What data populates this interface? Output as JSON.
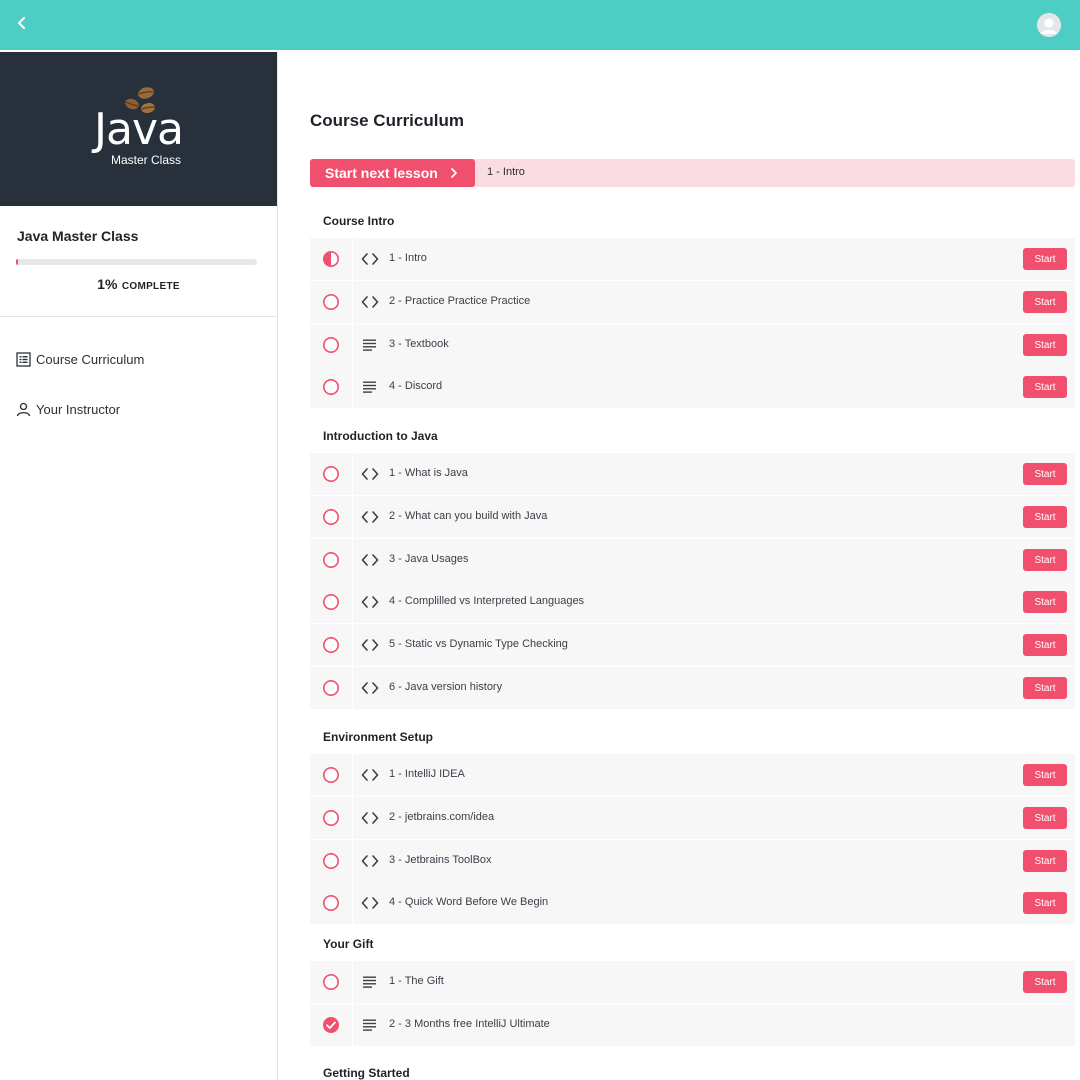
{
  "colors": {
    "topbar": "#4ecdc4",
    "accent": "#f0506e",
    "sidebar_header": "#28303c",
    "next_bar": "#fadce2"
  },
  "topbar": {
    "back_icon": "chevron-left-icon",
    "avatar_icon": "user-avatar-icon"
  },
  "logo": {
    "title": "Java",
    "subtitle": "Master Class",
    "icon": "coffee-beans-icon"
  },
  "sidebar": {
    "course_title": "Java Master Class",
    "progress_percent": 1,
    "progress_value": "1%",
    "progress_label": "COMPLETE",
    "nav": [
      {
        "label": "Course Curriculum",
        "icon": "list-icon"
      },
      {
        "label": "Your Instructor",
        "icon": "person-icon"
      }
    ]
  },
  "main": {
    "title": "Course Curriculum",
    "next_button": "Start next lesson",
    "next_lesson": "1 - Intro",
    "sections": [
      {
        "title": "Course Intro",
        "lessons": [
          {
            "name": "1 - Intro",
            "type": "code",
            "status": "half",
            "action": "Start"
          },
          {
            "name": "2 - Practice Practice Practice",
            "type": "code",
            "status": "empty",
            "action": "Start"
          },
          {
            "name": "3 - Textbook",
            "type": "text",
            "status": "empty",
            "action": "Start"
          },
          {
            "name": "4 - Discord",
            "type": "text",
            "status": "empty",
            "action": "Start"
          }
        ]
      },
      {
        "title": "Introduction to Java",
        "lessons": [
          {
            "name": "1 - What is Java",
            "type": "code",
            "status": "empty",
            "action": "Start"
          },
          {
            "name": "2 - What can you build with Java",
            "type": "code",
            "status": "empty",
            "action": "Start"
          },
          {
            "name": "3 - Java Usages",
            "type": "code",
            "status": "empty",
            "action": "Start"
          },
          {
            "name": "4 - Complilled vs Interpreted Languages",
            "type": "code",
            "status": "empty",
            "action": "Start"
          },
          {
            "name": "5 - Static vs Dynamic Type Checking",
            "type": "code",
            "status": "empty",
            "action": "Start"
          },
          {
            "name": "6 - Java version history",
            "type": "code",
            "status": "empty",
            "action": "Start"
          }
        ]
      },
      {
        "title": "Environment Setup",
        "lessons": [
          {
            "name": "1 - IntelliJ IDEA",
            "type": "code",
            "status": "empty",
            "action": "Start"
          },
          {
            "name": "2 - jetbrains.com/idea",
            "type": "code",
            "status": "empty",
            "action": "Start"
          },
          {
            "name": "3 - Jetbrains ToolBox",
            "type": "code",
            "status": "empty",
            "action": "Start"
          },
          {
            "name": "4 - Quick Word Before We Begin",
            "type": "code",
            "status": "empty",
            "action": "Start"
          }
        ]
      },
      {
        "title": "Your Gift",
        "lessons": [
          {
            "name": "1 - The Gift",
            "type": "text",
            "status": "empty",
            "action": "Start"
          },
          {
            "name": "2 - 3 Months free IntelliJ Ultimate",
            "type": "text",
            "status": "complete",
            "action": ""
          }
        ]
      },
      {
        "title": "Getting Started",
        "lessons": []
      }
    ]
  }
}
